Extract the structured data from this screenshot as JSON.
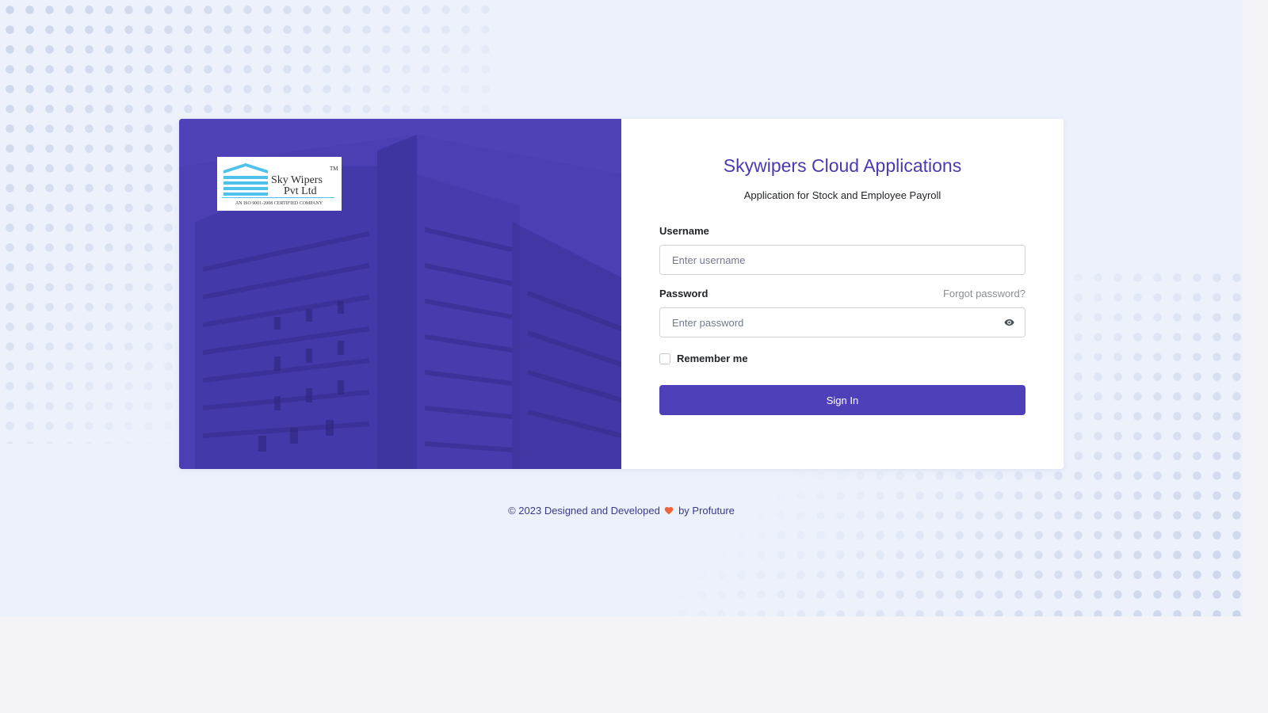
{
  "brand": {
    "logo_text_line1": "Sky Wipers",
    "logo_text_line2": "Pvt Ltd",
    "logo_tm": "TM",
    "logo_tagline": "AN ISO 9001-2008 CERTIFIED COMPANY",
    "accent_color": "#4b3fb3"
  },
  "login": {
    "title": "Skywipers Cloud Applications",
    "subtitle": "Application for Stock and Employee Payroll",
    "username_label": "Username",
    "username_placeholder": "Enter username",
    "password_label": "Password",
    "forgot_label": "Forgot password?",
    "password_placeholder": "Enter password",
    "remember_label": "Remember me",
    "signin_label": "Sign In"
  },
  "icons": {
    "password_toggle": "eye-icon",
    "footer_heart": "heart-icon"
  },
  "footer": {
    "prefix": "© 2023 Designed and Developed",
    "suffix": "by Profuture",
    "heart_color": "#f0643c"
  }
}
